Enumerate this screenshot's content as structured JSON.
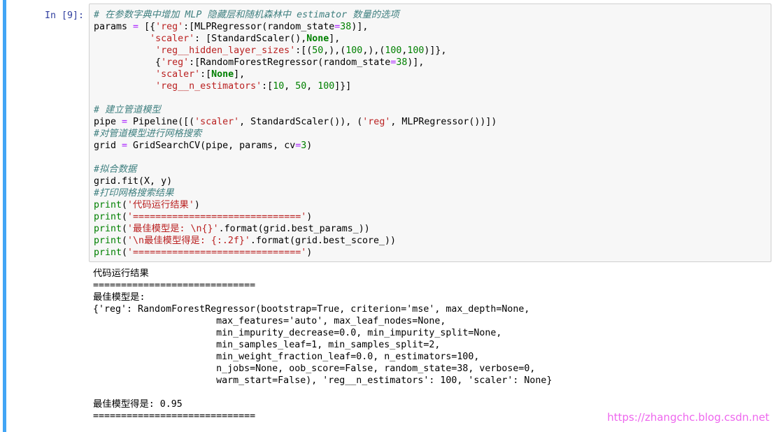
{
  "prompt": "In [9]:",
  "code": [
    {
      "name": "line-1",
      "tokens": [
        [
          "cm",
          "# 在参数字典中增加 MLP 隐藏层和随机森林中 estimator 数量的选项"
        ]
      ]
    },
    {
      "name": "line-2",
      "tokens": [
        [
          "",
          "params "
        ],
        [
          "op",
          "="
        ],
        [
          "",
          " [{"
        ],
        [
          "st",
          "'reg'"
        ],
        [
          "",
          ":[MLPRegressor(random_state"
        ],
        [
          "op",
          "="
        ],
        [
          "nu",
          "38"
        ],
        [
          "",
          ")],"
        ]
      ]
    },
    {
      "name": "line-3",
      "tokens": [
        [
          "",
          "          "
        ],
        [
          "st",
          "'scaler'"
        ],
        [
          "",
          ": [StandardScaler(),"
        ],
        [
          "kw",
          "None"
        ],
        [
          "",
          "],"
        ]
      ]
    },
    {
      "name": "line-4",
      "tokens": [
        [
          "",
          "           "
        ],
        [
          "st",
          "'reg__hidden_layer_sizes'"
        ],
        [
          "",
          ":[("
        ],
        [
          "nu",
          "50"
        ],
        [
          "",
          ",),("
        ],
        [
          "nu",
          "100"
        ],
        [
          "",
          ",),("
        ],
        [
          "nu",
          "100"
        ],
        [
          "",
          ","
        ],
        [
          "nu",
          "100"
        ],
        [
          "",
          ")]},"
        ]
      ]
    },
    {
      "name": "line-5",
      "tokens": [
        [
          "",
          "           {"
        ],
        [
          "st",
          "'reg'"
        ],
        [
          "",
          ":[RandomForestRegressor(random_state"
        ],
        [
          "op",
          "="
        ],
        [
          "nu",
          "38"
        ],
        [
          "",
          ")],"
        ]
      ]
    },
    {
      "name": "line-6",
      "tokens": [
        [
          "",
          "           "
        ],
        [
          "st",
          "'scaler'"
        ],
        [
          "",
          ":["
        ],
        [
          "kw",
          "None"
        ],
        [
          "",
          "],"
        ]
      ]
    },
    {
      "name": "line-7",
      "tokens": [
        [
          "",
          "           "
        ],
        [
          "st",
          "'reg__n_estimators'"
        ],
        [
          "",
          ":["
        ],
        [
          "nu",
          "10"
        ],
        [
          "",
          ", "
        ],
        [
          "nu",
          "50"
        ],
        [
          "",
          ", "
        ],
        [
          "nu",
          "100"
        ],
        [
          "",
          "]}]"
        ]
      ]
    },
    {
      "name": "line-8",
      "tokens": []
    },
    {
      "name": "line-9",
      "tokens": [
        [
          "cm",
          "# 建立管道模型"
        ]
      ]
    },
    {
      "name": "line-10",
      "tokens": [
        [
          "",
          "pipe "
        ],
        [
          "op",
          "="
        ],
        [
          "",
          " Pipeline([("
        ],
        [
          "st",
          "'scaler'"
        ],
        [
          "",
          ", StandardScaler()), ("
        ],
        [
          "st",
          "'reg'"
        ],
        [
          "",
          ", MLPRegressor())])"
        ]
      ]
    },
    {
      "name": "line-11",
      "tokens": [
        [
          "cm",
          "#对管道模型进行网格搜索"
        ]
      ]
    },
    {
      "name": "line-12",
      "tokens": [
        [
          "",
          "grid "
        ],
        [
          "op",
          "="
        ],
        [
          "",
          " GridSearchCV(pipe, params, cv"
        ],
        [
          "op",
          "="
        ],
        [
          "nu",
          "3"
        ],
        [
          "",
          ")"
        ]
      ]
    },
    {
      "name": "line-13",
      "tokens": []
    },
    {
      "name": "line-14",
      "tokens": [
        [
          "cm",
          "#拟合数据"
        ]
      ]
    },
    {
      "name": "line-15",
      "tokens": [
        [
          "",
          "grid.fit(X, y)"
        ]
      ]
    },
    {
      "name": "line-16",
      "tokens": [
        [
          "cm",
          "#打印网格搜索结果"
        ]
      ]
    },
    {
      "name": "line-17",
      "tokens": [
        [
          "bi",
          "print"
        ],
        [
          "",
          "("
        ],
        [
          "st",
          "'代码运行结果'"
        ],
        [
          "",
          ")"
        ]
      ]
    },
    {
      "name": "line-18",
      "tokens": [
        [
          "bi",
          "print"
        ],
        [
          "",
          "("
        ],
        [
          "st",
          "'=============================='"
        ],
        [
          "",
          ")"
        ]
      ]
    },
    {
      "name": "line-19",
      "tokens": [
        [
          "bi",
          "print"
        ],
        [
          "",
          "("
        ],
        [
          "st",
          "'最佳模型是: \\n{}'"
        ],
        [
          "",
          ".format(grid.best_params_))"
        ]
      ]
    },
    {
      "name": "line-20",
      "tokens": [
        [
          "bi",
          "print"
        ],
        [
          "",
          "("
        ],
        [
          "st",
          "'\\n最佳模型得是: {:.2f}'"
        ],
        [
          "",
          ".format(grid.best_score_))"
        ]
      ]
    },
    {
      "name": "line-21",
      "tokens": [
        [
          "bi",
          "print"
        ],
        [
          "",
          "("
        ],
        [
          "st",
          "'=============================='"
        ],
        [
          "",
          ")"
        ]
      ]
    }
  ],
  "output": [
    "代码运行结果",
    "=============================",
    "最佳模型是:",
    "{'reg': RandomForestRegressor(bootstrap=True, criterion='mse', max_depth=None,",
    "                      max_features='auto', max_leaf_nodes=None,",
    "                      min_impurity_decrease=0.0, min_impurity_split=None,",
    "                      min_samples_leaf=1, min_samples_split=2,",
    "                      min_weight_fraction_leaf=0.0, n_estimators=100,",
    "                      n_jobs=None, oob_score=False, random_state=38, verbose=0,",
    "                      warm_start=False), 'reg__n_estimators': 100, 'scaler': None}",
    "",
    "最佳模型得是: 0.95",
    "============================="
  ],
  "watermark": "https://zhangchc.blog.csdn.net"
}
